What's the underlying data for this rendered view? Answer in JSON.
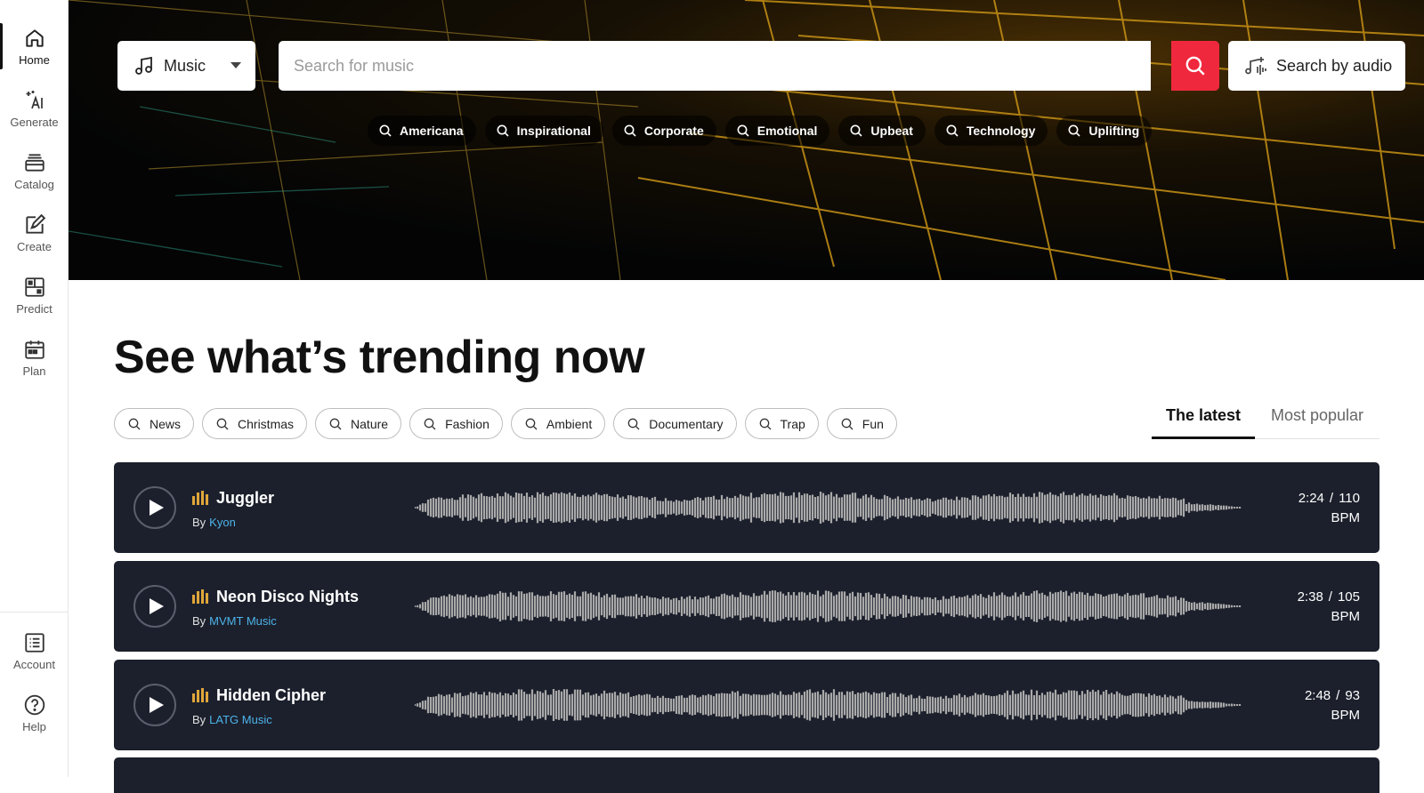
{
  "sidebar": {
    "items": [
      {
        "label": "Home",
        "icon": "home-icon"
      },
      {
        "label": "Generate",
        "icon": "ai-sparkle-icon"
      },
      {
        "label": "Catalog",
        "icon": "catalog-icon"
      },
      {
        "label": "Create",
        "icon": "create-edit-icon"
      },
      {
        "label": "Predict",
        "icon": "predict-icon"
      },
      {
        "label": "Plan",
        "icon": "calendar-icon"
      }
    ],
    "bottom_items": [
      {
        "label": "Account",
        "icon": "list-icon"
      },
      {
        "label": "Help",
        "icon": "help-icon"
      }
    ]
  },
  "search": {
    "type_label": "Music",
    "placeholder": "Search for music",
    "audio_label": "Search by audio"
  },
  "hero_chips": [
    "Americana",
    "Inspirational",
    "Corporate",
    "Emotional",
    "Upbeat",
    "Technology",
    "Uplifting"
  ],
  "main": {
    "title": "See what’s trending now",
    "filters": [
      "News",
      "Christmas",
      "Nature",
      "Fashion",
      "Ambient",
      "Documentary",
      "Trap",
      "Fun"
    ],
    "tabs": [
      "The latest",
      "Most popular"
    ]
  },
  "tracks": [
    {
      "title": "Juggler",
      "by": "By",
      "artist": "Kyon",
      "duration": "2:24",
      "bpm": "110",
      "bpm_unit": "BPM",
      "sep": "/"
    },
    {
      "title": "Neon Disco Nights",
      "by": "By",
      "artist": "MVMT Music",
      "duration": "2:38",
      "bpm": "105",
      "bpm_unit": "BPM",
      "sep": "/"
    },
    {
      "title": "Hidden Cipher",
      "by": "By",
      "artist": "LATG Music",
      "duration": "2:48",
      "bpm": "93",
      "bpm_unit": "BPM",
      "sep": "/"
    }
  ],
  "colors": {
    "accent": "#f0283d",
    "track_bg": "#1c202c",
    "artist_link": "#4db3ea",
    "eq": "#e0a63a"
  }
}
